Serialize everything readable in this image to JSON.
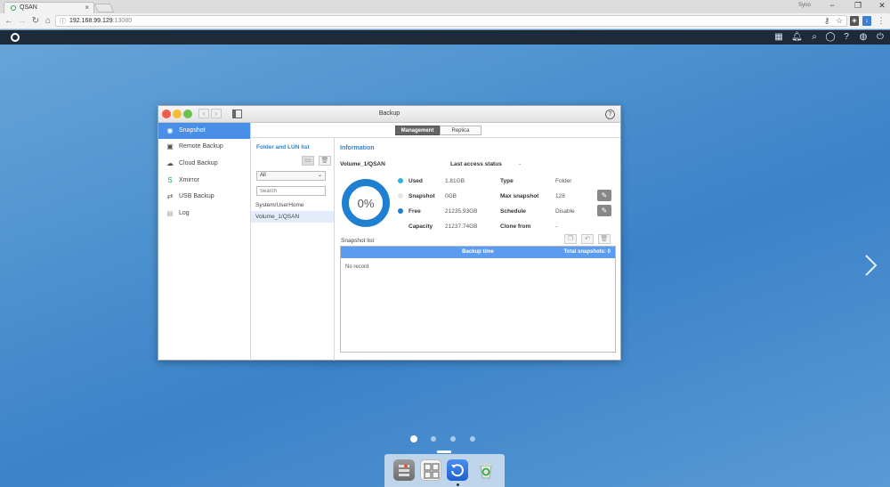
{
  "browser": {
    "tab_title": "QSAN",
    "tab_close": "×",
    "user_label": "Syno",
    "url_host": "192.168.99.129",
    "url_port": ":13080",
    "info_icon": "info-icon",
    "window_controls": [
      "−",
      "❐",
      "✕"
    ]
  },
  "backup_window": {
    "title": "Backup",
    "help": "?",
    "tabs": {
      "management": "Management",
      "replica": "Replica"
    },
    "sidebar": [
      {
        "label": "Snapshot",
        "icon": "snapshot-icon",
        "glyph": "◉",
        "active": true
      },
      {
        "label": "Remote Backup",
        "icon": "remote-backup-icon",
        "glyph": "▣",
        "active": false
      },
      {
        "label": "Cloud Backup",
        "icon": "cloud-backup-icon",
        "glyph": "☁",
        "active": false
      },
      {
        "label": "Xmirror",
        "icon": "xmirror-icon",
        "glyph": "S",
        "active": false
      },
      {
        "label": "USB Backup",
        "icon": "usb-icon",
        "glyph": "⇄",
        "active": false
      },
      {
        "label": "Log",
        "icon": "log-icon",
        "glyph": "▤",
        "active": false
      }
    ],
    "folder_pane": {
      "title": "Folder and LUN list",
      "filter_value": "All",
      "search_placeholder": "Search",
      "folders": [
        "System/UserHome",
        "Volume_1/QSAN"
      ],
      "selected_index": 1
    },
    "information": {
      "title": "Information",
      "volume_name": "Volume_1/QSAN",
      "last_access_label": "Last access status",
      "last_access_value": "-",
      "percent_used": "0%",
      "used_fraction": 0.0,
      "stats": [
        {
          "label": "Used",
          "value": "1.81GB",
          "color": "#2fb4d9"
        },
        {
          "label": "Snapshot",
          "value": "0GB",
          "color": "#e6e6e6"
        },
        {
          "label": "Free",
          "value": "21235.93GB",
          "color": "#1f7fd1"
        },
        {
          "label": "Capacity",
          "value": "21237.74GB",
          "color": ""
        }
      ],
      "props": [
        {
          "label": "Type",
          "value": "Folder"
        },
        {
          "label": "Max snapshot",
          "value": "128"
        },
        {
          "label": "Schedule",
          "value": "Disable"
        },
        {
          "label": "Clone from",
          "value": "-"
        }
      ]
    },
    "snapshot_list": {
      "label": "Snapshot list",
      "col_backup_time": "Backup time",
      "total_snapshots": "Total snapshots: 0",
      "empty_text": "No record"
    }
  },
  "colors": {
    "accent": "#4a8fe7",
    "donut_track": "#1f7fd1",
    "table_header": "#5b9cf0"
  }
}
